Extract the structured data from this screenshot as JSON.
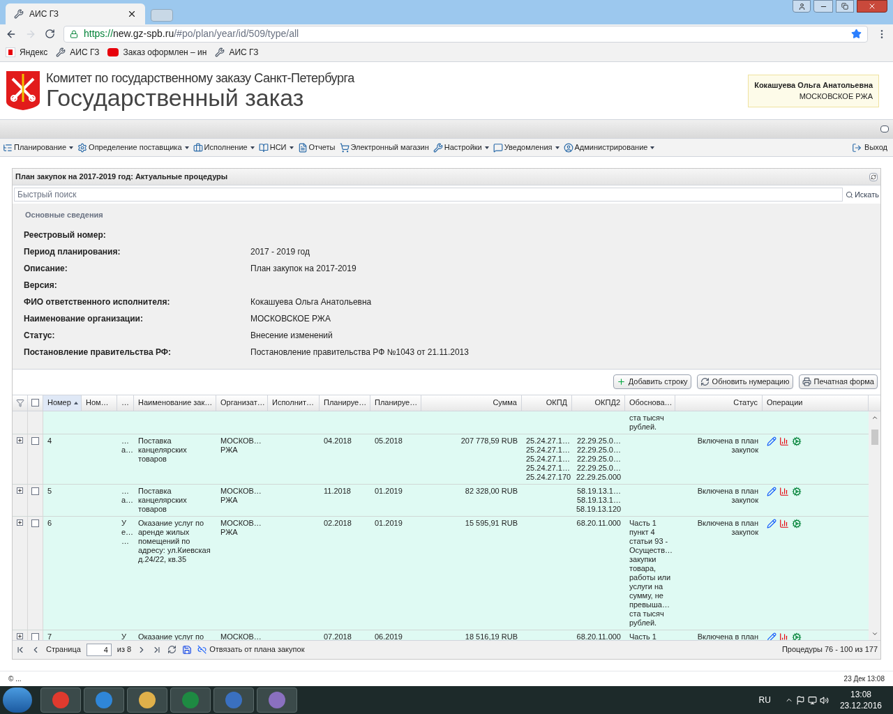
{
  "browser": {
    "tab_title": "АИС ГЗ",
    "url": {
      "scheme": "https://",
      "host": "new.gz-spb.ru",
      "path": "/#po/plan/year/id/509/type/all"
    },
    "bookmarks": [
      {
        "label": "Яндекс",
        "kind": "yandex"
      },
      {
        "label": "АИС ГЗ",
        "kind": "tool"
      },
      {
        "label": "Заказ оформлен – ин",
        "kind": "yu"
      },
      {
        "label": "АИС ГЗ",
        "kind": "tool"
      }
    ]
  },
  "header": {
    "org_line": "Комитет по государственному заказу Санкт-Петербурга",
    "title": "Государственный заказ",
    "user": {
      "name": "Кокашуева Ольга Анатольевна",
      "org": "МОСКОВСКОЕ РЖА"
    }
  },
  "menu": {
    "items": [
      {
        "label": "Планирование",
        "dropdown": true
      },
      {
        "label": "Определение поставщика",
        "dropdown": true
      },
      {
        "label": "Исполнение",
        "dropdown": true
      },
      {
        "label": "НСИ",
        "dropdown": true
      },
      {
        "label": "Отчеты",
        "dropdown": false
      },
      {
        "label": "Электронный магазин",
        "dropdown": false
      },
      {
        "label": "Настройки",
        "dropdown": true
      },
      {
        "label": "Уведомления",
        "dropdown": true
      },
      {
        "label": "Администрирование",
        "dropdown": true
      }
    ],
    "logout": "Выход"
  },
  "panel": {
    "title": "План закупок на 2017-2019 год: Актуальные процедуры",
    "search": {
      "placeholder": "Быстрый поиск",
      "button": "Искать"
    },
    "info": {
      "title": "Основные сведения",
      "fields": [
        {
          "label": "Реестровый номер:"
        },
        {
          "label": "Период планирования:",
          "value": "2017 - 2019 год"
        },
        {
          "label": "Описание:",
          "value": "План закупок на 2017-2019"
        },
        {
          "label": "Версия:"
        },
        {
          "label": "ФИО ответственного исполнителя:",
          "value": "Кокашуева Ольга Анатольевна"
        },
        {
          "label": "Наименование организации:",
          "value": "МОСКОВСКОЕ РЖА"
        },
        {
          "label": "Статус:",
          "value": "Внесение изменений"
        },
        {
          "label": "Постановление правительства РФ:",
          "value": "Постановление правительства РФ №1043 от 21.11.2013"
        }
      ]
    },
    "toolbar": [
      "Добавить строку",
      "Обновить нумерацию",
      "Печатная форма"
    ],
    "grid": {
      "header_checked": false,
      "columns": [
        {
          "label": "Номер",
          "sorted": true
        },
        {
          "label": "Ном…"
        },
        {
          "label": "…"
        },
        {
          "label": "Наименование зак…"
        },
        {
          "label": "Организат…"
        },
        {
          "label": "Исполнит…"
        },
        {
          "label": "Планируе…"
        },
        {
          "label": "Планируе…"
        },
        {
          "label": "Сумма"
        },
        {
          "label": "ОКПД"
        },
        {
          "label": "ОКПД2"
        },
        {
          "label": "Обоснова…"
        },
        {
          "label": "Статус"
        },
        {
          "label": "Операции"
        }
      ],
      "rows": [
        {
          "justification": [
            "ста тысяч",
            "рублей."
          ]
        },
        {
          "number": "4",
          "checked": false,
          "column_3": [
            "…",
            "а…"
          ],
          "name": [
            "Поставка",
            "канцелярских",
            "товаров"
          ],
          "organization": [
            "МОСКОВ…",
            "РЖА"
          ],
          "planned_1": "04.2018",
          "planned_2": "05.2018",
          "sum": "207 778,59 RUB",
          "okpd": [
            "25.24.27.1…",
            "25.24.27.1…",
            "25.24.27.1…",
            "25.24.27.1…",
            "25.24.27.170"
          ],
          "okpd2": [
            "22.29.25.0…",
            "22.29.25.0…",
            "22.29.25.0…",
            "22.29.25.0…",
            "22.29.25.000"
          ],
          "status": [
            "Включена в план",
            "закупок"
          ]
        },
        {
          "number": "5",
          "checked": false,
          "column_3": [
            "…",
            "а…"
          ],
          "name": [
            "Поставка",
            "канцелярских",
            "товаров"
          ],
          "organization": [
            "МОСКОВ…",
            "РЖА"
          ],
          "planned_1": "11.2018",
          "planned_2": "01.2019",
          "sum": "82 328,00 RUB",
          "okpd2": [
            "58.19.13.1…",
            "58.19.13.1…",
            "58.19.13.120"
          ],
          "status": [
            "Включена в план",
            "закупок"
          ]
        },
        {
          "number": "6",
          "checked": false,
          "column_3": [
            "У",
            "е…",
            "…"
          ],
          "name": [
            "Оказание услуг по",
            "аренде жилых",
            "помещений по",
            "адресу: ул.Киевская",
            "д.24/22, кв.35"
          ],
          "organization": [
            "МОСКОВ…",
            "РЖА"
          ],
          "planned_1": "02.2018",
          "planned_2": "01.2019",
          "sum": "15 595,91 RUB",
          "okpd2": [
            "68.20.11.000"
          ],
          "justification": [
            "Часть 1",
            "пункт 4",
            "статьи 93 -",
            "Осуществ…",
            "закупки",
            "товара,",
            "работы или",
            "услуги на",
            "сумму, не",
            "превыша…",
            "ста тысяч",
            "рублей."
          ],
          "status": [
            "Включена в план",
            "закупок"
          ]
        },
        {
          "number": "7",
          "checked": false,
          "column_3": [
            "У"
          ],
          "name": [
            "Оказание услуг по"
          ],
          "organization": [
            "МОСКОВ…"
          ],
          "planned_1": "07.2018",
          "planned_2": "06.2019",
          "sum": "18 516,19 RUB",
          "okpd2": [
            "68.20.11.000"
          ],
          "justification": [
            "Часть 1"
          ],
          "status": [
            "Включена в план"
          ]
        }
      ]
    },
    "paging": {
      "page_label": "Страница",
      "page": "4",
      "of": "из 8",
      "unlink": "Отвязать от плана закупок",
      "summary": "Процедуры 76 - 100 из 177"
    }
  },
  "footer": {
    "left": "© ...",
    "right": "23 Дек 13:08"
  },
  "taskbar": {
    "lang": "RU",
    "time": "13:08",
    "date": "23.12.2016"
  }
}
